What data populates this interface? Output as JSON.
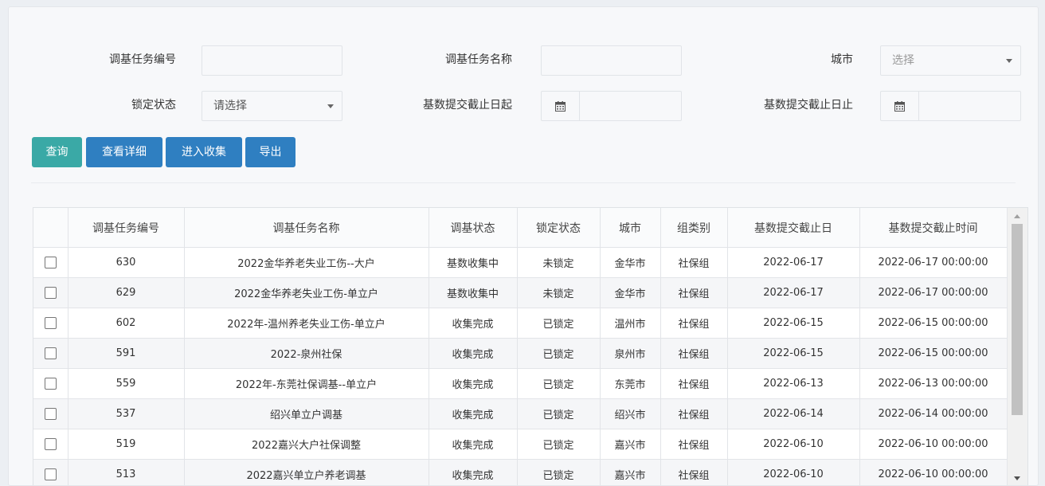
{
  "filters": {
    "task_no_label": "调基任务编号",
    "task_no_value": "",
    "task_name_label": "调基任务名称",
    "task_name_value": "",
    "city_label": "城市",
    "city_placeholder": "选择",
    "lock_label": "锁定状态",
    "lock_value": "请选择",
    "deadline_from_label": "基数提交截止日起",
    "deadline_to_label": "基数提交截止日止",
    "calendar_icon": "calendar-icon"
  },
  "buttons": {
    "query": "查询",
    "detail": "查看详细",
    "collect": "进入收集",
    "export": "导出"
  },
  "colors": {
    "query_button": "#3aa9a6",
    "primary_button": "#2f7fc1"
  },
  "table": {
    "columns": [
      "调基任务编号",
      "调基任务名称",
      "调基状态",
      "锁定状态",
      "城市",
      "组类别",
      "基数提交截止日",
      "基数提交截止时间"
    ],
    "rows": [
      [
        "630",
        "2022金华养老失业工伤--大户",
        "基数收集中",
        "未锁定",
        "金华市",
        "社保组",
        "2022-06-17",
        "2022-06-17 00:00:00"
      ],
      [
        "629",
        "2022金华养老失业工伤-单立户",
        "基数收集中",
        "未锁定",
        "金华市",
        "社保组",
        "2022-06-17",
        "2022-06-17 00:00:00"
      ],
      [
        "602",
        "2022年-温州养老失业工伤-单立户",
        "收集完成",
        "已锁定",
        "温州市",
        "社保组",
        "2022-06-15",
        "2022-06-15 00:00:00"
      ],
      [
        "591",
        "2022-泉州社保",
        "收集完成",
        "已锁定",
        "泉州市",
        "社保组",
        "2022-06-15",
        "2022-06-15 00:00:00"
      ],
      [
        "559",
        "2022年-东莞社保调基--单立户",
        "收集完成",
        "已锁定",
        "东莞市",
        "社保组",
        "2022-06-13",
        "2022-06-13 00:00:00"
      ],
      [
        "537",
        "绍兴单立户调基",
        "收集完成",
        "已锁定",
        "绍兴市",
        "社保组",
        "2022-06-14",
        "2022-06-14 00:00:00"
      ],
      [
        "519",
        "2022嘉兴大户社保调整",
        "收集完成",
        "已锁定",
        "嘉兴市",
        "社保组",
        "2022-06-10",
        "2022-06-10 00:00:00"
      ],
      [
        "513",
        "2022嘉兴单立户养老调基",
        "收集完成",
        "已锁定",
        "嘉兴市",
        "社保组",
        "2022-06-10",
        "2022-06-10 00:00:00"
      ]
    ]
  }
}
